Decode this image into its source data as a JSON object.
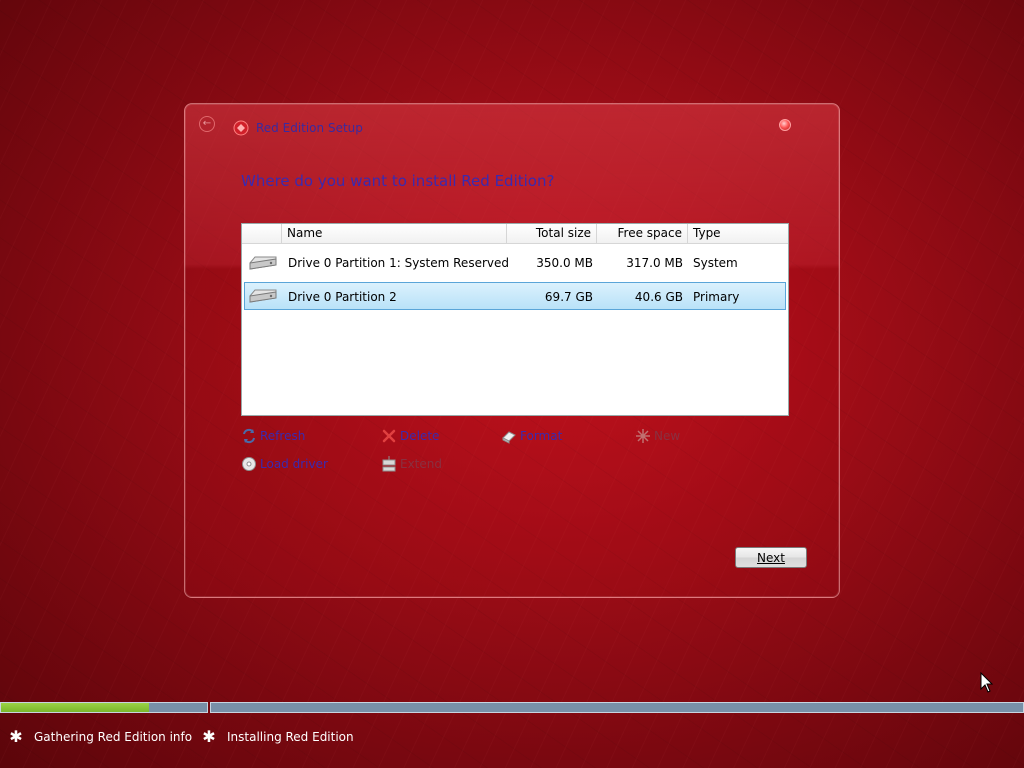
{
  "dialog": {
    "title": "Red Edition Setup",
    "question": "Where do you want to install Red Edition?",
    "icons": {
      "back": "back-arrow-icon",
      "app": "setup-icon",
      "close": "close-icon"
    }
  },
  "table": {
    "columns": [
      "Name",
      "Total size",
      "Free space",
      "Type"
    ],
    "rows": [
      {
        "name": "Drive 0 Partition 1: System Reserved",
        "total": "350.0 MB",
        "free": "317.0 MB",
        "type": "System",
        "selected": false
      },
      {
        "name": "Drive 0 Partition 2",
        "total": "69.7 GB",
        "free": "40.6 GB",
        "type": "Primary",
        "selected": true
      }
    ]
  },
  "actions": {
    "refresh": "Refresh",
    "delete": "Delete",
    "format": "Format",
    "new": "New",
    "load_driver": "Load driver",
    "extend": "Extend"
  },
  "buttons": {
    "next": "Next"
  },
  "status": {
    "steps": [
      "Gathering Red Edition info",
      "Installing Red Edition"
    ],
    "progress_step1": 0.72,
    "progress_step2": 0.0
  },
  "colors": {
    "accent_text": "#3a2ab0",
    "progress_fill": "#86c435",
    "background": "#a00d17"
  }
}
